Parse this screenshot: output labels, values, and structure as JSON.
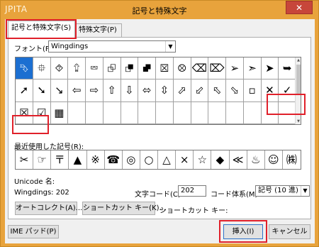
{
  "window": {
    "app_name": "JPITA",
    "title": "記号と特殊文字",
    "close": "✕"
  },
  "tabs": [
    {
      "label": "記号と特殊文字(S)"
    },
    {
      "label": "特殊文字(P)"
    }
  ],
  "font": {
    "label": "フォント(F):",
    "value": "Wingdings"
  },
  "grid": {
    "rows": [
      [
        "⮷",
        "⯐",
        "⯑",
        "⮸",
        "⮹",
        "⮺",
        "⮻",
        "⮼",
        "⮽",
        "⮾",
        "⌫",
        "⌦",
        "➤",
        "➤",
        "➤",
        "➤"
      ],
      [
        "➚",
        "➘",
        "➘",
        "⇦",
        "⇨",
        "⇧",
        "⇩",
        "⬄",
        "⇳",
        "⬀",
        "⬃",
        "⬁",
        "⬂",
        "▭",
        "✕",
        "✓"
      ],
      [
        "☒",
        "☑",
        "⊞",
        "",
        "",
        "",
        "",
        "",
        "",
        "",
        "",
        "",
        "",
        "",
        "",
        ""
      ]
    ],
    "rows_text": [
      [
        "⮷",
        "⯐",
        "⯑",
        "⮸",
        "⮹",
        "⮺",
        "⮻",
        "⮼",
        "⮽",
        "⮾",
        "⌫",
        "⌦",
        "➢",
        "➢",
        "➢",
        "➢"
      ],
      [
        "➚",
        "➘",
        "➘",
        "←",
        "→",
        "↑",
        "↓",
        "↖",
        "↗",
        "↙",
        "↘",
        "⬅",
        "➡",
        "⬆",
        "⬇",
        "▫"
      ],
      [
        "☒",
        "☑",
        "▦"
      ]
    ],
    "selected_index": 0,
    "highlight_color": "#e0202a",
    "selection_color": "#1c6fd1"
  },
  "grid_display": {
    "row1": [
      "⮷",
      "⯐",
      "⯑",
      "⮸",
      "⮹",
      "⮺",
      "⮻",
      "⮼",
      "⮽",
      "⮾",
      "⌫",
      "⌦",
      "➢",
      "➣",
      "➤",
      "➥"
    ],
    "row2": [
      "➚",
      "➘",
      "↘",
      "⇦",
      "⇨",
      "⇧",
      "⇩",
      "⬄",
      "⇳",
      "⬀",
      "⬃",
      "⬁",
      "⬂",
      "▫",
      "✕",
      "✓"
    ],
    "row3": [
      "☒",
      "☑",
      "▦"
    ]
  },
  "recent": {
    "label": "最近使用した記号(R):",
    "items": [
      "✂",
      "☞",
      "〒",
      "▲",
      "※",
      "☎",
      "◎",
      "○",
      "△",
      "×",
      "☆",
      "◆",
      "≪",
      "♨",
      "☺",
      "㈱"
    ]
  },
  "unicode": {
    "name_label": "Unicode 名:",
    "font_code": "Wingdings: 202"
  },
  "code": {
    "label": "文字コード(C):",
    "value": "202",
    "system_label": "コード体系(M):",
    "system_value": "記号 (10 進)"
  },
  "buttons": {
    "autocorrect": "オートコレクト(A)...",
    "shortcut": "ショートカット キー(K)...",
    "shortcut_key_label": "ショートカット キー:",
    "ime": "IME パッド(P)",
    "insert": "挿入(I)",
    "cancel": "キャンセル"
  }
}
